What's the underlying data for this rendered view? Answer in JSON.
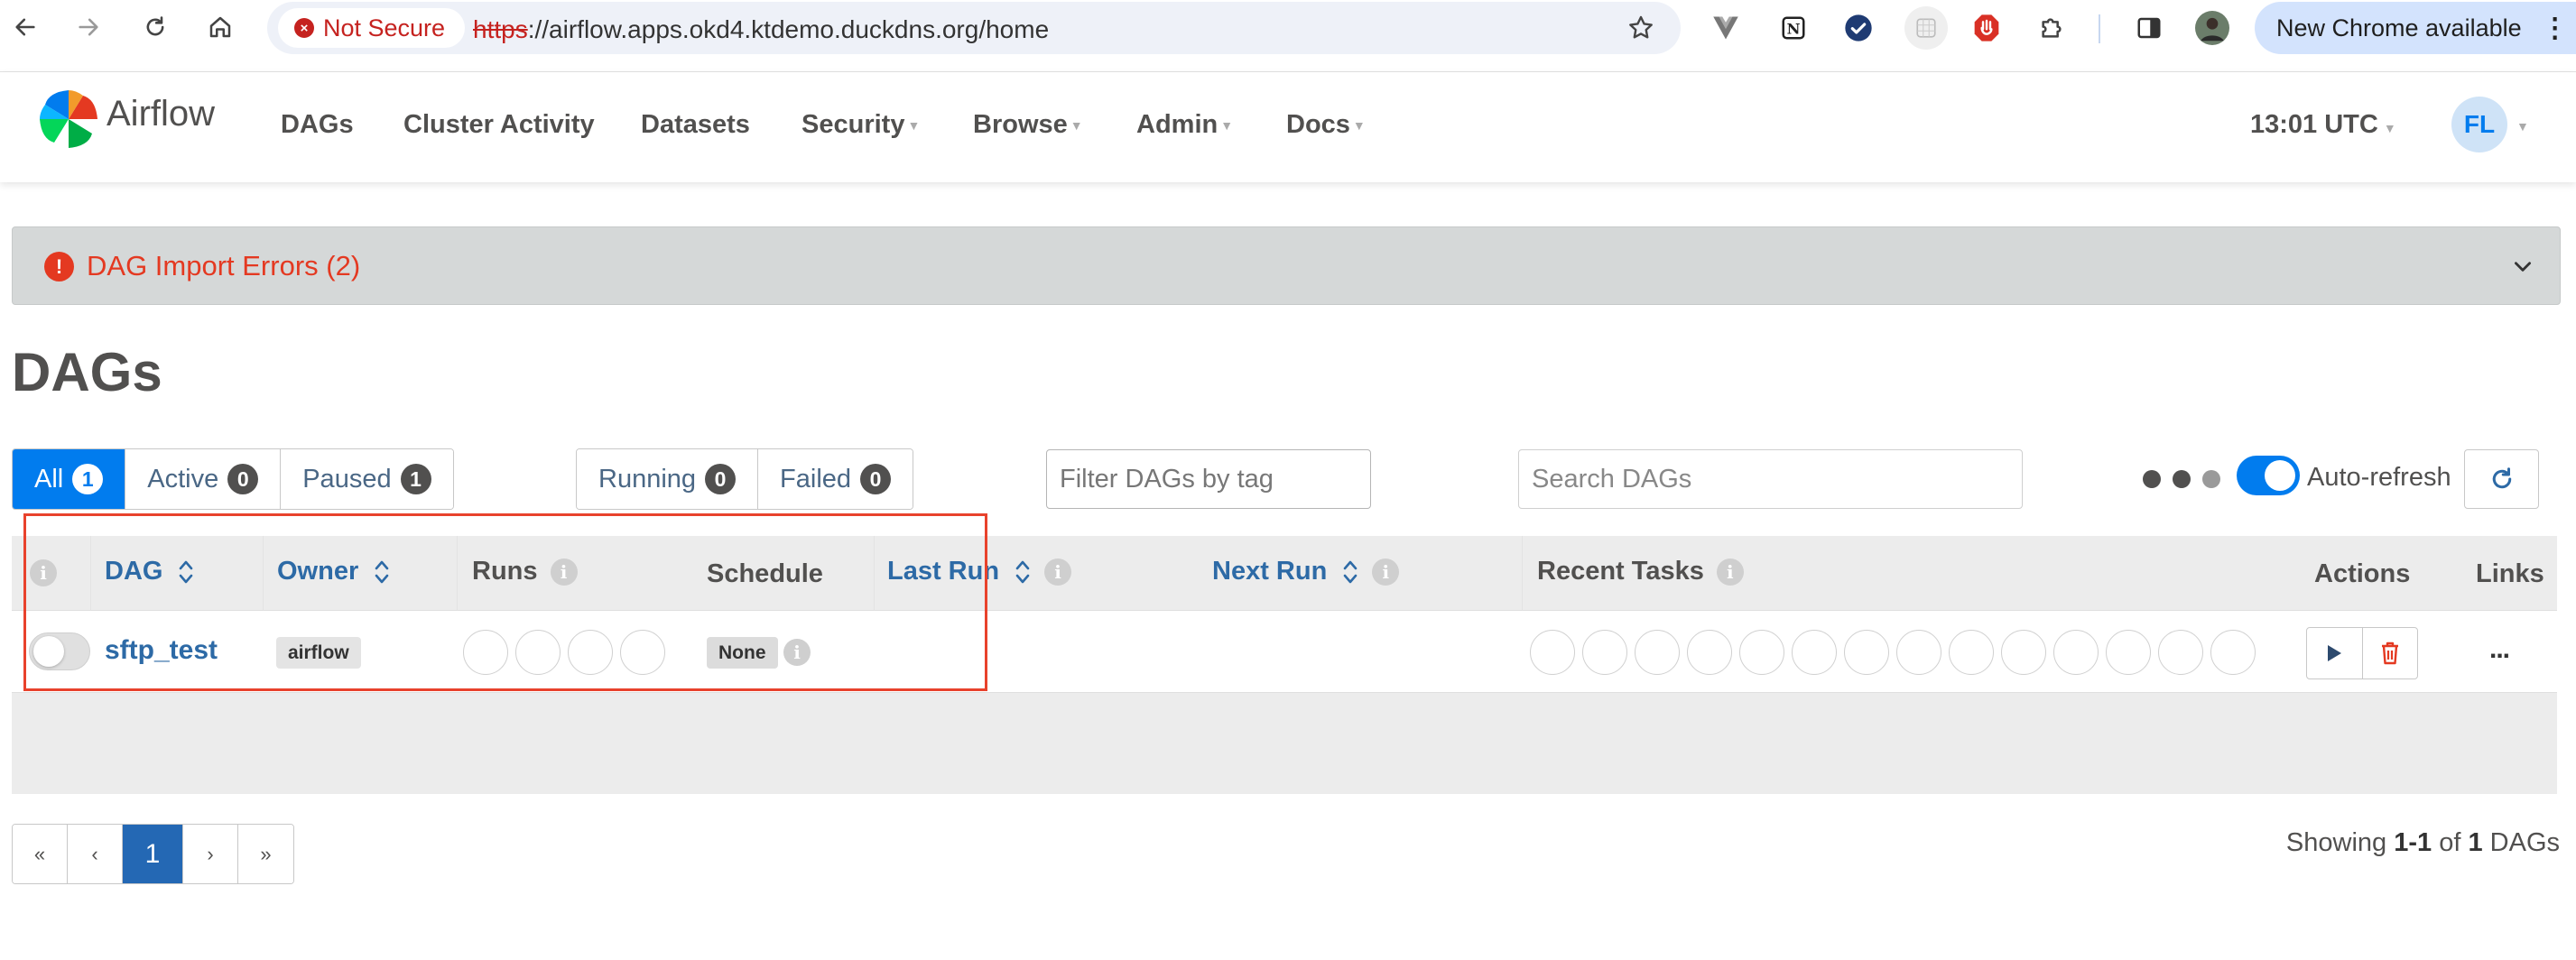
{
  "browser": {
    "security_label": "Not Secure",
    "url_scheme": "https",
    "url_rest": "://airflow.apps.okd4.ktdemo.duckdns.org/home",
    "update_label": "New Chrome available"
  },
  "navbar": {
    "brand": "Airflow",
    "menu": [
      "DAGs",
      "Cluster Activity",
      "Datasets",
      "Security",
      "Browse",
      "Admin",
      "Docs"
    ],
    "time": "13:01 UTC",
    "user_initials": "FL"
  },
  "import_errors": {
    "label": "DAG Import Errors (2)"
  },
  "page": {
    "title": "DAGs"
  },
  "status_filter": [
    {
      "label": "All",
      "count": "1",
      "active": true
    },
    {
      "label": "Active",
      "count": "0",
      "active": false
    },
    {
      "label": "Paused",
      "count": "1",
      "active": false
    }
  ],
  "run_filter": [
    {
      "label": "Running",
      "count": "0"
    },
    {
      "label": "Failed",
      "count": "0"
    }
  ],
  "tag_filter": {
    "placeholder": "Filter DAGs by tag"
  },
  "search": {
    "placeholder": "Search DAGs"
  },
  "autorefresh": {
    "label": "Auto-refresh",
    "enabled": true
  },
  "table": {
    "headers": {
      "dag": "DAG",
      "owner": "Owner",
      "runs": "Runs",
      "schedule": "Schedule",
      "last_run": "Last Run",
      "next_run": "Next Run",
      "recent_tasks": "Recent Tasks",
      "actions": "Actions",
      "links": "Links"
    },
    "rows": [
      {
        "dag_id": "sftp_test",
        "owner": "airflow",
        "schedule": "None",
        "paused": true,
        "links_more": "..."
      }
    ]
  },
  "pagination": {
    "first": "«",
    "prev": "‹",
    "current": "1",
    "next": "›",
    "last": "»"
  },
  "showing": {
    "prefix": "Showing",
    "range": "1-1",
    "of": "of",
    "total": "1",
    "suffix": "DAGs"
  },
  "colors": {
    "accent": "#017cee",
    "error": "#e43921",
    "highlight": "#e8422c",
    "link": "#2d6aa6"
  }
}
